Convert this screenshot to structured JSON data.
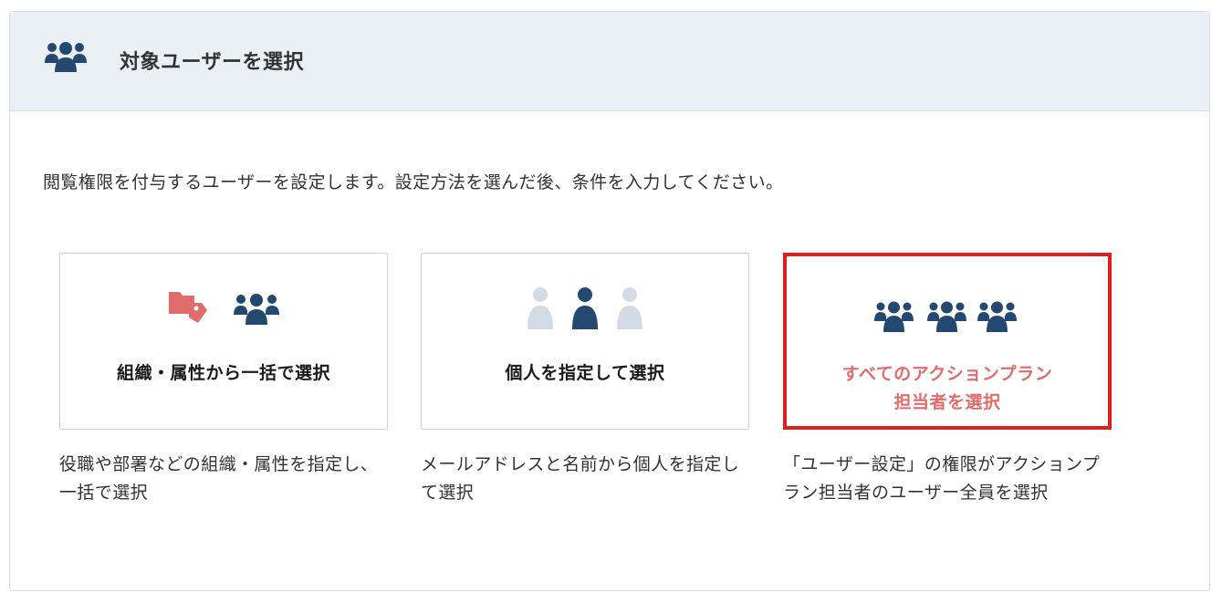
{
  "header": {
    "icon": "users-group-icon",
    "title": "対象ユーザーを選択"
  },
  "description": "閲覧権限を付与するユーザーを設定します。設定方法を選んだ後、条件を入力してください。",
  "options": [
    {
      "label": "組織・属性から一括で選択",
      "icon": "org-tag-users-icon",
      "description": "役職や部署などの組織・属性を指定し、一括で選択"
    },
    {
      "label": "個人を指定して選択",
      "icon": "individual-user-icon",
      "description": "メールアドレスと名前から個人を指定して選択"
    },
    {
      "label_line1": "すべてのアクションプラン",
      "label_line2": "担当者を選択",
      "icon": "all-users-icon",
      "description": "「ユーザー設定」の権限がアクションプラン担当者のユーザー全員を選択",
      "selected": true
    }
  ],
  "colors": {
    "header_bg": "#ebf0f7",
    "icon_navy": "#244970",
    "icon_light": "#d3dbe5",
    "tag_red": "#e06c6c",
    "selected_border": "#e02020",
    "selected_label": "#e06c6c"
  }
}
